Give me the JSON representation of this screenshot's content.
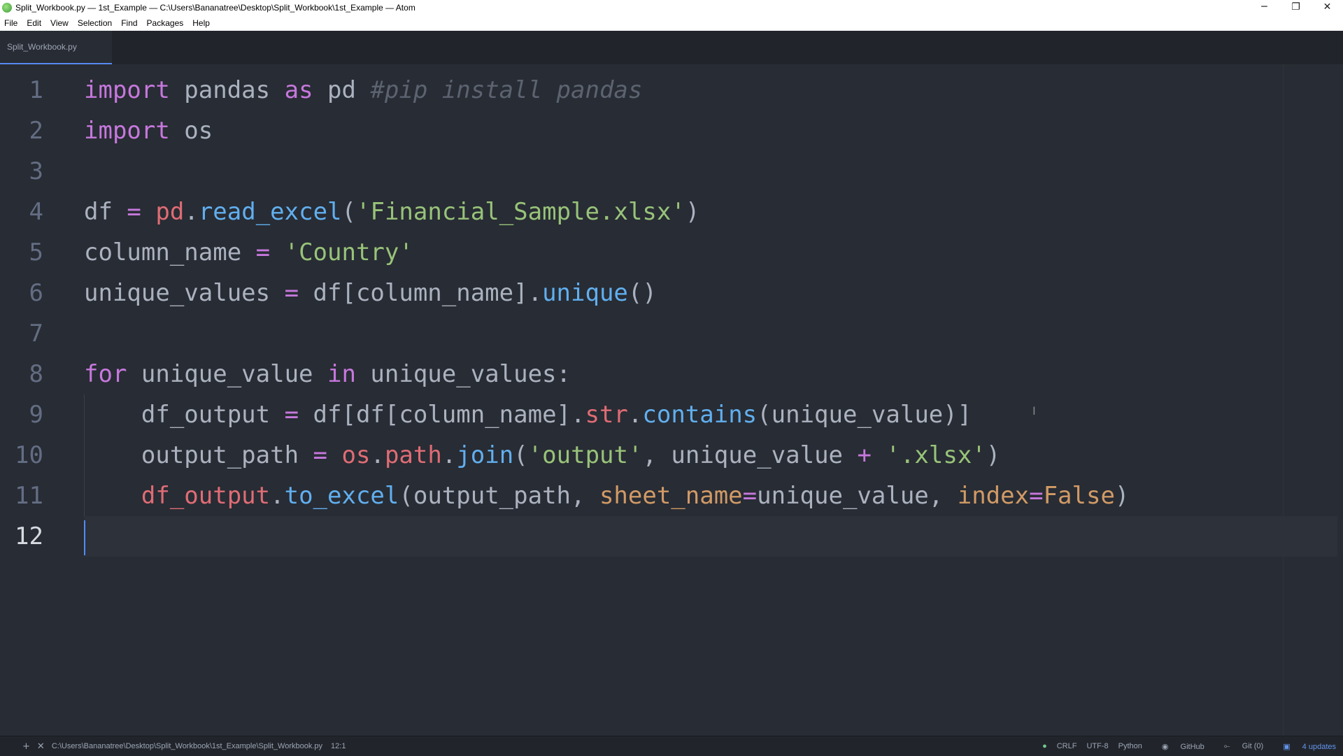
{
  "window": {
    "title": "Split_Workbook.py — 1st_Example — C:\\Users\\Bananatree\\Desktop\\Split_Workbook\\1st_Example — Atom",
    "minimize": "─",
    "restore": "❐",
    "close": "✕"
  },
  "menu": {
    "items": [
      "File",
      "Edit",
      "View",
      "Selection",
      "Find",
      "Packages",
      "Help"
    ]
  },
  "tabs": [
    {
      "title": "Split_Workbook.py",
      "active": true
    }
  ],
  "editor": {
    "line_numbers": [
      "1",
      "2",
      "3",
      "4",
      "5",
      "6",
      "7",
      "8",
      "9",
      "10",
      "11",
      "12"
    ],
    "active_line": 12,
    "lines": {
      "l1": {
        "kw1": "import",
        "t1": " pandas ",
        "kw2": "as",
        "t2": " pd ",
        "cm": "#pip install pandas"
      },
      "l2": {
        "kw1": "import",
        "t1": " os"
      },
      "l4": {
        "t1": "df ",
        "op1": "=",
        "t2": " ",
        "obj1": "pd",
        "t3": ".",
        "fn1": "read_excel",
        "t4": "(",
        "str1": "'Financial_Sample.xlsx'",
        "t5": ")"
      },
      "l5": {
        "t1": "column_name ",
        "op1": "=",
        "t2": " ",
        "str1": "'Country'"
      },
      "l6": {
        "t1": "unique_values ",
        "op1": "=",
        "t2": " df[column_name].",
        "fn1": "unique",
        "t3": "()"
      },
      "l8": {
        "kw1": "for",
        "t1": " unique_value ",
        "kw2": "in",
        "t2": " unique_values:"
      },
      "l9": {
        "t0": "    ",
        "t1": "df_output ",
        "op1": "=",
        "t2": " df[df[column_name].",
        "obj1": "str",
        "t3": ".",
        "fn1": "contains",
        "t4": "(unique_value)]"
      },
      "l10": {
        "t0": "    ",
        "t1": "output_path ",
        "op1": "=",
        "t2": " ",
        "obj1": "os",
        "t3": ".",
        "obj2": "path",
        "t4": ".",
        "fn1": "join",
        "t5": "(",
        "str1": "'output'",
        "t6": ", unique_value ",
        "op2": "+",
        "t7": " ",
        "str2": "'.xlsx'",
        "t8": ")"
      },
      "l11": {
        "t0": "    ",
        "obj1": "df_output",
        "t1": ".",
        "fn1": "to_excel",
        "t2": "(output_path, ",
        "attr1": "sheet_name",
        "op1": "=",
        "t3": "unique_value, ",
        "attr2": "index",
        "op2": "=",
        "attr3": "False",
        "t4": ")"
      }
    }
  },
  "status": {
    "add_icon": "+",
    "close_icon": "✕",
    "path": "C:\\Users\\Bananatree\\Desktop\\Split_Workbook\\1st_Example\\Split_Workbook.py",
    "cursor_pos": "12:1",
    "line_ending": "CRLF",
    "encoding": "UTF-8",
    "grammar": "Python",
    "github": "GitHub",
    "git": "Git (0)",
    "updates": "4 updates"
  },
  "colors": {
    "editor_bg": "#282c34",
    "keyword": "#c678dd",
    "string": "#98c379",
    "function": "#61afef",
    "object": "#e06c75",
    "attribute": "#d19a66",
    "comment": "#5c6370"
  }
}
